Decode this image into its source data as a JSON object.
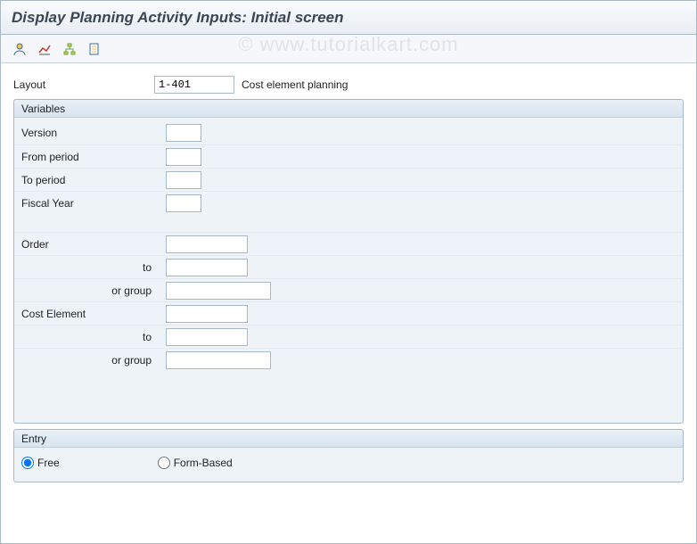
{
  "header": {
    "title": "Display Planning Activity Inputs: Initial screen"
  },
  "toolbar": {
    "icons": [
      "person-icon",
      "graph-icon",
      "hierarchy-icon",
      "doc-icon"
    ]
  },
  "layout": {
    "label": "Layout",
    "value": "1-401",
    "desc": "Cost element planning"
  },
  "variables": {
    "title": "Variables",
    "version_label": "Version",
    "version_value": "",
    "from_label": "From period",
    "from_value": "",
    "to_label": "To period",
    "to_value": "",
    "fy_label": "Fiscal Year",
    "fy_value": "",
    "order_label": "Order",
    "order_value": "",
    "order_to_label": "to",
    "order_to_value": "",
    "order_grp_label": "or group",
    "order_grp_value": "",
    "ce_label": "Cost Element",
    "ce_value": "",
    "ce_to_label": "to",
    "ce_to_value": "",
    "ce_grp_label": "or group",
    "ce_grp_value": ""
  },
  "entry": {
    "title": "Entry",
    "free_label": "Free",
    "form_label": "Form-Based",
    "selected": "free"
  },
  "watermark": "© www.tutorialkart.com"
}
